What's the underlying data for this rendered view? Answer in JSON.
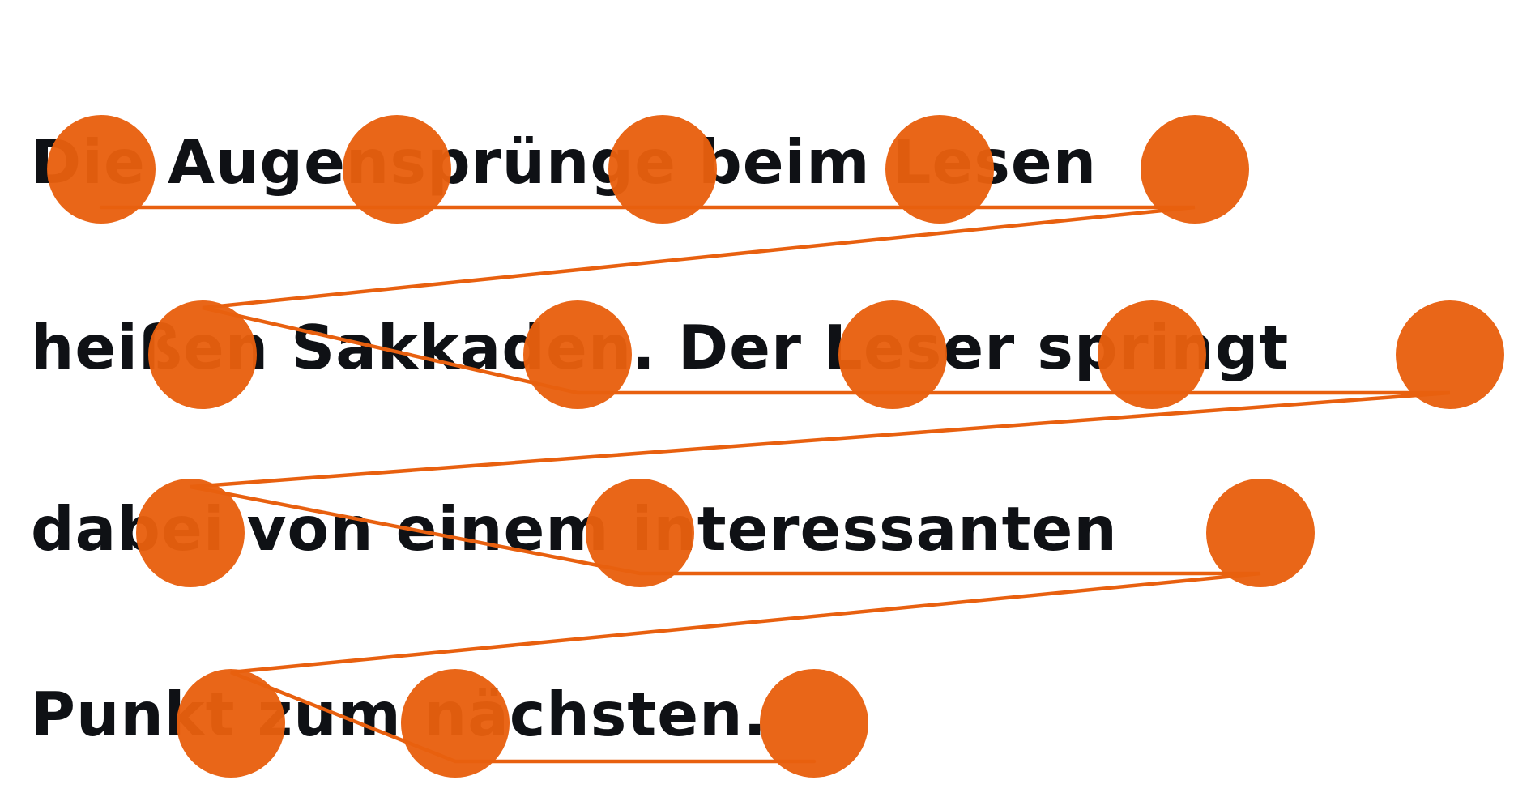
{
  "lines": [
    "Die Augensprünge beim Lesen",
    "heißen Sakkaden. Der Leser springt",
    "dabei von einem interessanten",
    "Punkt zum nächsten."
  ],
  "colors": {
    "fixation": "#e8600f",
    "saccade": "#e8600f",
    "text": "#0f1115",
    "background": "#ffffff"
  }
}
